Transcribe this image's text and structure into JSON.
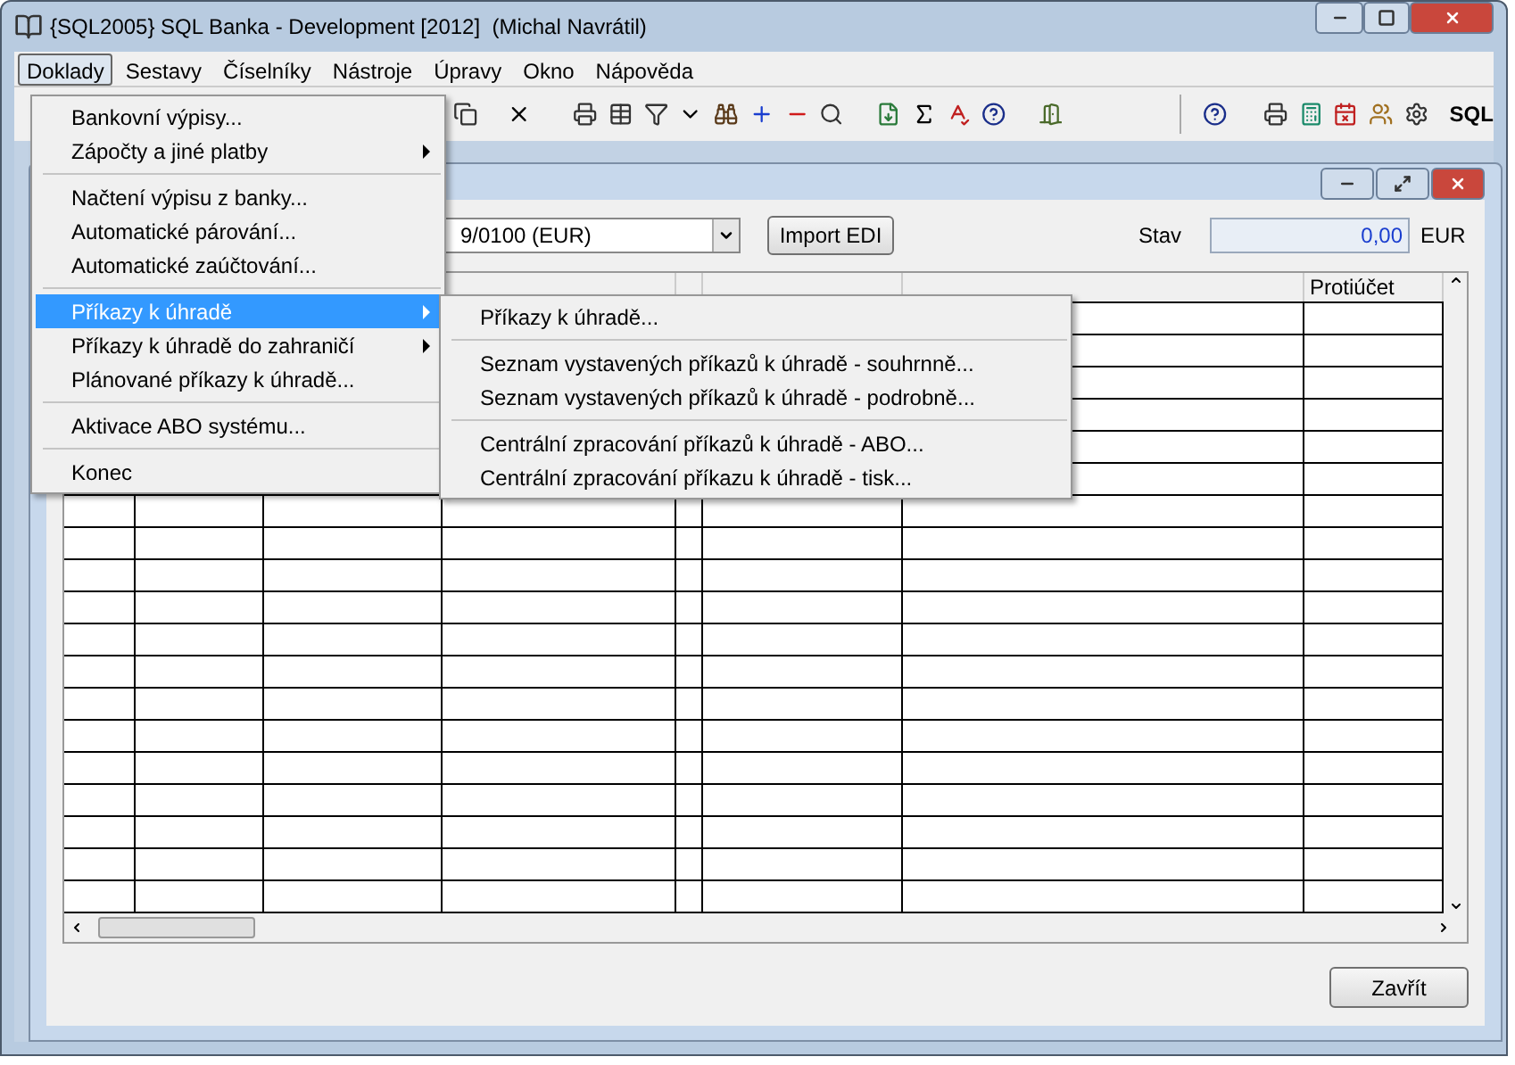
{
  "window": {
    "title": "{SQL2005} SQL Banka - Development [2012]  (Michal Navrátil)"
  },
  "menubar": [
    {
      "label": "Doklady",
      "selected": true
    },
    {
      "label": "Sestavy",
      "selected": false
    },
    {
      "label": "Číselníky",
      "selected": false
    },
    {
      "label": "Nástroje",
      "selected": false
    },
    {
      "label": "Úpravy",
      "selected": false
    },
    {
      "label": "Okno",
      "selected": false
    },
    {
      "label": "Nápověda",
      "selected": false
    }
  ],
  "toolbar": {
    "sql_label": "SQL"
  },
  "doklady_menu": [
    {
      "kind": "item",
      "label": "Bankovní výpisy...",
      "submenu": false,
      "selected": false
    },
    {
      "kind": "item",
      "label": "Zápočty a jiné platby",
      "submenu": true,
      "selected": false
    },
    {
      "kind": "separator"
    },
    {
      "kind": "item",
      "label": "Načtení výpisu z banky...",
      "submenu": false,
      "selected": false
    },
    {
      "kind": "item",
      "label": "Automatické párování...",
      "submenu": false,
      "selected": false
    },
    {
      "kind": "item",
      "label": "Automatické zaúčtování...",
      "submenu": false,
      "selected": false
    },
    {
      "kind": "separator"
    },
    {
      "kind": "item",
      "label": "Příkazy k úhradě",
      "submenu": true,
      "selected": true
    },
    {
      "kind": "item",
      "label": "Příkazy k úhradě do zahraničí",
      "submenu": true,
      "selected": false
    },
    {
      "kind": "item",
      "label": "Plánované příkazy k úhradě...",
      "submenu": false,
      "selected": false
    },
    {
      "kind": "separator"
    },
    {
      "kind": "item",
      "label": "Aktivace ABO systému...",
      "submenu": false,
      "selected": false
    },
    {
      "kind": "separator"
    },
    {
      "kind": "item",
      "label": "Konec",
      "submenu": false,
      "selected": false
    }
  ],
  "submenu": [
    {
      "kind": "item",
      "label": "Příkazy k úhradě..."
    },
    {
      "kind": "separator"
    },
    {
      "kind": "item",
      "label": "Seznam vystavených příkazů k úhradě - souhrnně..."
    },
    {
      "kind": "item",
      "label": "Seznam vystavených příkazů k úhradě - podrobně..."
    },
    {
      "kind": "separator"
    },
    {
      "kind": "item",
      "label": "Centrální zpracování příkazů k úhradě - ABO..."
    },
    {
      "kind": "item",
      "label": "Centrální zpracování příkazu k úhradě - tisk..."
    }
  ],
  "form": {
    "account_combo": "9/0100 (EUR)",
    "import_button": "Import EDI",
    "status_label": "Stav",
    "status_value": "0,00",
    "currency": "EUR"
  },
  "table": {
    "columns": [
      {},
      {},
      {},
      {},
      {},
      {},
      {},
      {
        "label": "Protiúčet"
      }
    ]
  },
  "close_button": "Zavřít"
}
